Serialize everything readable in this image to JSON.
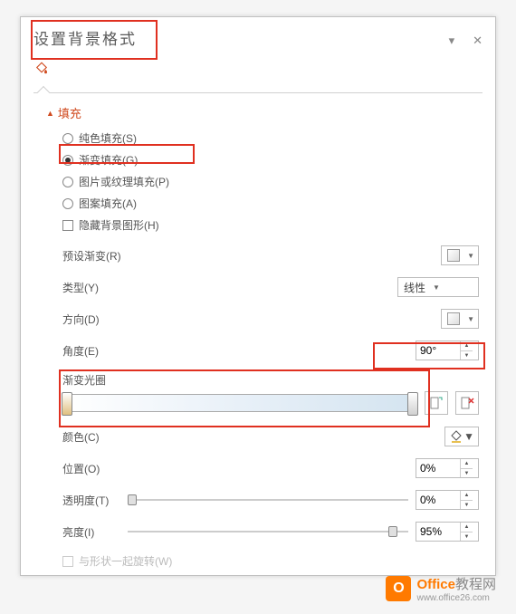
{
  "header": {
    "title": "设置背景格式"
  },
  "section": {
    "name": "填充"
  },
  "fill_options": {
    "solid": "纯色填充(S)",
    "gradient": "渐变填充(G)",
    "picture": "图片或纹理填充(P)",
    "pattern": "图案填充(A)",
    "hide_shapes": "隐藏背景图形(H)"
  },
  "gradient": {
    "preset_label": "预设渐变(R)",
    "type_label": "类型(Y)",
    "type_value": "线性",
    "direction_label": "方向(D)",
    "angle_label": "角度(E)",
    "angle_value": "90°",
    "stops_label": "渐变光圈",
    "color_label": "颜色(C)",
    "position_label": "位置(O)",
    "position_value": "0%",
    "transparency_label": "透明度(T)",
    "transparency_value": "0%",
    "brightness_label": "亮度(I)",
    "brightness_value": "95%",
    "rotate_label": "与形状一起旋转(W)"
  },
  "chart_data": {
    "type": "bar",
    "categories": [
      "透明度",
      "亮度"
    ],
    "values": [
      0,
      95
    ],
    "xlabel": "",
    "ylabel": "%",
    "ylim": [
      0,
      100
    ]
  },
  "watermark": {
    "brand_colored": "Office",
    "brand_gray": "教程网",
    "url": "www.office26.com"
  }
}
